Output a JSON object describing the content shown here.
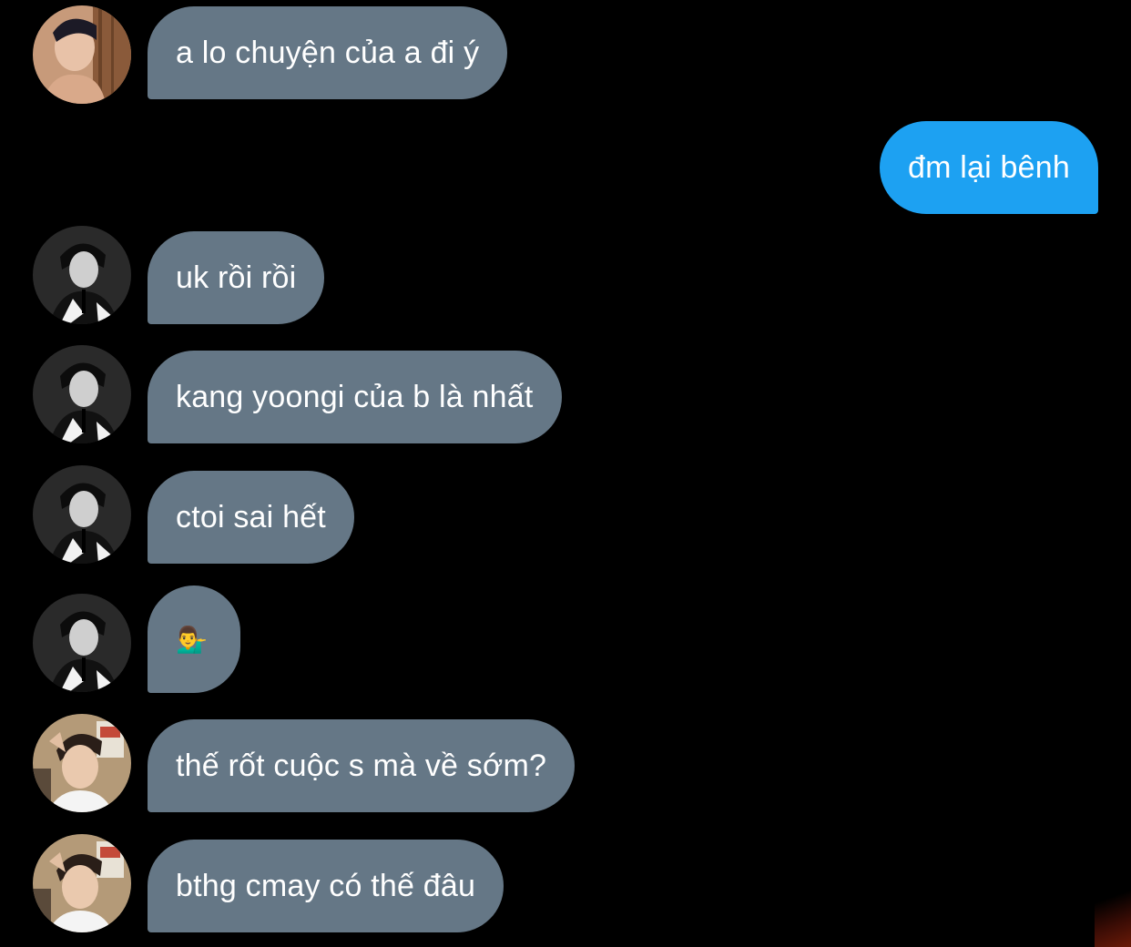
{
  "messages": [
    {
      "side": "in",
      "avatar": "avatar-woodwall",
      "text": "a lo chuyện của a đi ý"
    },
    {
      "side": "out",
      "text": "đm lại bênh"
    },
    {
      "side": "in",
      "avatar": "avatar-bw-suit",
      "text": "uk rồi rồi"
    },
    {
      "side": "in",
      "avatar": "avatar-bw-suit",
      "text": "kang yoongi của b là nhất"
    },
    {
      "side": "in",
      "avatar": "avatar-bw-suit",
      "text": "ctoi sai hết"
    },
    {
      "side": "in",
      "avatar": "avatar-bw-suit",
      "text": "💁‍♂️"
    },
    {
      "side": "in",
      "avatar": "avatar-selfie",
      "text": "thế rốt cuộc s mà về sớm?"
    },
    {
      "side": "in",
      "avatar": "avatar-selfie",
      "text": "bthg cmay có thế đâu"
    }
  ],
  "colors": {
    "background": "#000000",
    "incoming_bubble": "#657786",
    "outgoing_bubble": "#1da1f2",
    "text": "#ffffff"
  }
}
